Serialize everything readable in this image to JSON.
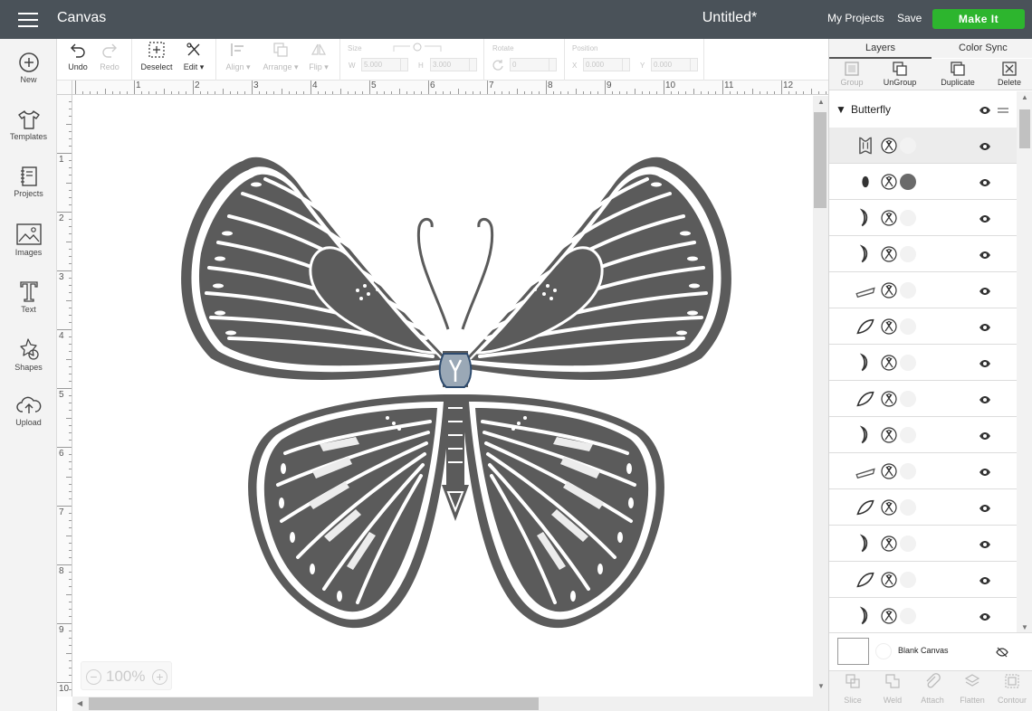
{
  "topbar": {
    "app_title": "Canvas",
    "doc_title": "Untitled*",
    "my_projects": "My Projects",
    "save": "Save",
    "make_it": "Make It",
    "make_it_color": "#2db52e",
    "bar_color": "#4a5259"
  },
  "leftbar": {
    "items": [
      {
        "label": "New",
        "icon": "plus-circle-icon"
      },
      {
        "label": "Templates",
        "icon": "tshirt-icon"
      },
      {
        "label": "Projects",
        "icon": "projects-icon"
      },
      {
        "label": "Images",
        "icon": "images-icon"
      },
      {
        "label": "Text",
        "icon": "text-icon"
      },
      {
        "label": "Shapes",
        "icon": "shapes-icon"
      },
      {
        "label": "Upload",
        "icon": "upload-icon"
      }
    ]
  },
  "toolbar": {
    "undo": "Undo",
    "redo": "Redo",
    "deselect": "Deselect",
    "edit": "Edit",
    "align": "Align",
    "arrange": "Arrange",
    "flip": "Flip",
    "size_label": "Size",
    "w_label": "W",
    "w_value": "5.000",
    "h_label": "H",
    "h_value": "3.000",
    "rotate_label": "Rotate",
    "rotate_value": "0",
    "position_label": "Position",
    "x_label": "X",
    "x_value": "0.000",
    "y_label": "Y",
    "y_value": "0.000"
  },
  "rulers": {
    "horizontal": [
      "1",
      "2",
      "3",
      "4",
      "5",
      "6",
      "7",
      "8",
      "9",
      "10",
      "11",
      "12"
    ],
    "vertical": [
      "1",
      "2",
      "3",
      "4",
      "5",
      "6",
      "7",
      "8",
      "9",
      "10"
    ]
  },
  "canvas": {
    "zoom_minus": "−",
    "zoom_value": "100%",
    "zoom_plus": "+",
    "butterfly_fill": "#5b5b5b",
    "butterfly_light": "#ececec"
  },
  "panel": {
    "tab_layers": "Layers",
    "tab_color_sync": "Color Sync",
    "tools": [
      {
        "label": "Group",
        "enabled": false
      },
      {
        "label": "UnGroup",
        "enabled": true
      },
      {
        "label": "Duplicate",
        "enabled": true
      },
      {
        "label": "Delete",
        "enabled": true
      }
    ],
    "group_name": "Butterfly",
    "layers": [
      {
        "shape": "outline-icon",
        "swatch": "#f2f2f2"
      },
      {
        "shape": "dot-icon",
        "swatch": "#6a6a6a"
      },
      {
        "shape": "crescent-icon",
        "swatch": "#f2f2f2"
      },
      {
        "shape": "crescent-icon",
        "swatch": "#f2f2f2"
      },
      {
        "shape": "feather-icon",
        "swatch": "#f2f2f2"
      },
      {
        "shape": "leaf-icon",
        "swatch": "#f2f2f2"
      },
      {
        "shape": "crescent-icon",
        "swatch": "#f2f2f2"
      },
      {
        "shape": "leaf-icon",
        "swatch": "#f2f2f2"
      },
      {
        "shape": "crescent-icon",
        "swatch": "#f2f2f2"
      },
      {
        "shape": "feather-icon",
        "swatch": "#f2f2f2"
      },
      {
        "shape": "leaf-icon",
        "swatch": "#f2f2f2"
      },
      {
        "shape": "crescent-icon",
        "swatch": "#f2f2f2"
      },
      {
        "shape": "leaf-icon",
        "swatch": "#f2f2f2"
      },
      {
        "shape": "crescent-icon",
        "swatch": "#f2f2f2"
      }
    ],
    "blank_canvas": "Blank Canvas",
    "bottom_tools": [
      "Slice",
      "Weld",
      "Attach",
      "Flatten",
      "Contour"
    ]
  }
}
